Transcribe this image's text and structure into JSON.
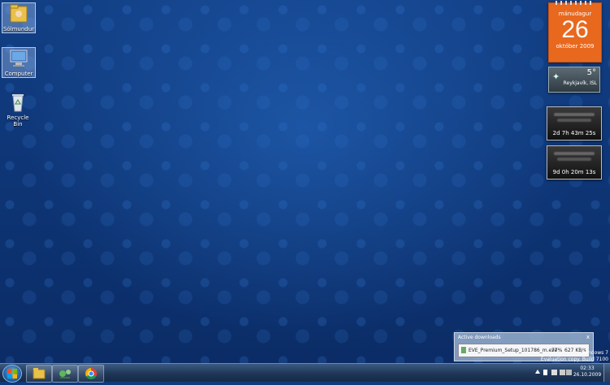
{
  "desktop": {
    "icons": [
      {
        "label": "Sólmundur",
        "icon": "folder-user-icon"
      },
      {
        "label": "Computer",
        "icon": "computer-icon"
      },
      {
        "label": "Recycle Bin",
        "icon": "recycle-bin-icon"
      }
    ]
  },
  "gadgets": {
    "calendar": {
      "weekday": "mánudagur",
      "day": "26",
      "month_year": "október 2009"
    },
    "weather": {
      "temperature": "5°",
      "city": "Reykjavík, ISL"
    },
    "timers": [
      {
        "value": "2d 7h 43m 25s"
      },
      {
        "value": "9d 0h 20m 13s"
      }
    ]
  },
  "downloads": {
    "title": "Active downloads",
    "close": "x",
    "item": {
      "filename": "EVE_Premium_Setup_101786_m.exe",
      "percent": "77%",
      "speed": "627 KB/s",
      "progress": 0.77
    }
  },
  "watermark": {
    "line1": "Windows 7",
    "line2": "Evaluation copy. Build 7100"
  },
  "taskbar": {
    "start": "start-orb-icon",
    "pinned": [
      "folder-icon",
      "network-app-icon",
      "chrome-icon"
    ],
    "clock": {
      "time": "02:33",
      "date": "26.10.2009"
    }
  }
}
